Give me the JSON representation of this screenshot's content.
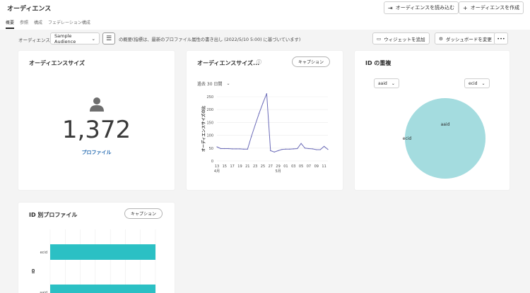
{
  "header": {
    "title": "オーディエンス",
    "load_button": "オーディエンスを読み込む",
    "create_button": "オーディエンスを作成"
  },
  "tabs": [
    {
      "label": "概要",
      "active": true
    },
    {
      "label": "参照",
      "active": false
    },
    {
      "label": "構成",
      "active": false
    },
    {
      "label": "フェデレーション構成",
      "active": false
    }
  ],
  "toolbar": {
    "audience_label": "オーディエンス",
    "audience_value": "Sample Audience",
    "summary": "の概要(指標は、最新のプロファイル属性の書き出し (2022/5/10 5:00) に基づいています)",
    "add_widget": "ウィジェットを追加",
    "edit_dashboard": "ダッシュボードを変更",
    "more": "•••"
  },
  "cards": {
    "size": {
      "title": "オーディエンスサイズ",
      "value": "1,372",
      "link": "プロファイル"
    },
    "trend": {
      "title": "オーディエンスサイズ...",
      "caption": "キャプション",
      "range": "過去 30 日間"
    },
    "overlap": {
      "title": "ID の重複",
      "left_select": "aaid",
      "right_select": "ecid"
    },
    "by_id": {
      "title": "ID 別プロファイル",
      "caption": "キャプション"
    }
  },
  "colors": {
    "accent": "#2bc0c4",
    "line": "#6b6bb8",
    "venn": "#a4dcdf",
    "link": "#2b6fb3"
  },
  "chart_data": [
    {
      "type": "line",
      "ylabel": "オーディエンスサイズの比",
      "y_ticks": [
        0,
        50,
        100,
        150,
        200,
        250
      ],
      "ylim": [
        0,
        250
      ],
      "x_ticks": [
        "13",
        "15",
        "17",
        "19",
        "21",
        "23",
        "25",
        "27",
        "29",
        "01",
        "03",
        "05",
        "07",
        "09",
        "11"
      ],
      "month_labels": [
        {
          "at": "13",
          "label": "4月"
        },
        {
          "at": "29",
          "label": "5月"
        }
      ],
      "x": [
        "13",
        "14",
        "15",
        "16",
        "17",
        "18",
        "19",
        "20",
        "21",
        "22",
        "23",
        "24",
        "25",
        "26",
        "27",
        "28",
        "29",
        "30",
        "01",
        "02",
        "03",
        "04",
        "05",
        "06",
        "07",
        "08",
        "09",
        "10",
        "11",
        "12"
      ],
      "values": [
        55,
        48,
        48,
        48,
        47,
        47,
        47,
        46,
        46,
        95,
        140,
        185,
        225,
        262,
        40,
        35,
        40,
        45,
        46,
        46,
        47,
        48,
        68,
        50,
        48,
        47,
        44,
        44,
        57,
        45
      ],
      "grid": true
    },
    {
      "type": "venn",
      "sets": [
        "aaid",
        "ecid"
      ]
    },
    {
      "type": "bar",
      "orientation": "horizontal",
      "ylabel": "ID",
      "categories": [
        "ecid",
        "aaid"
      ],
      "values": [
        100,
        100
      ]
    }
  ]
}
